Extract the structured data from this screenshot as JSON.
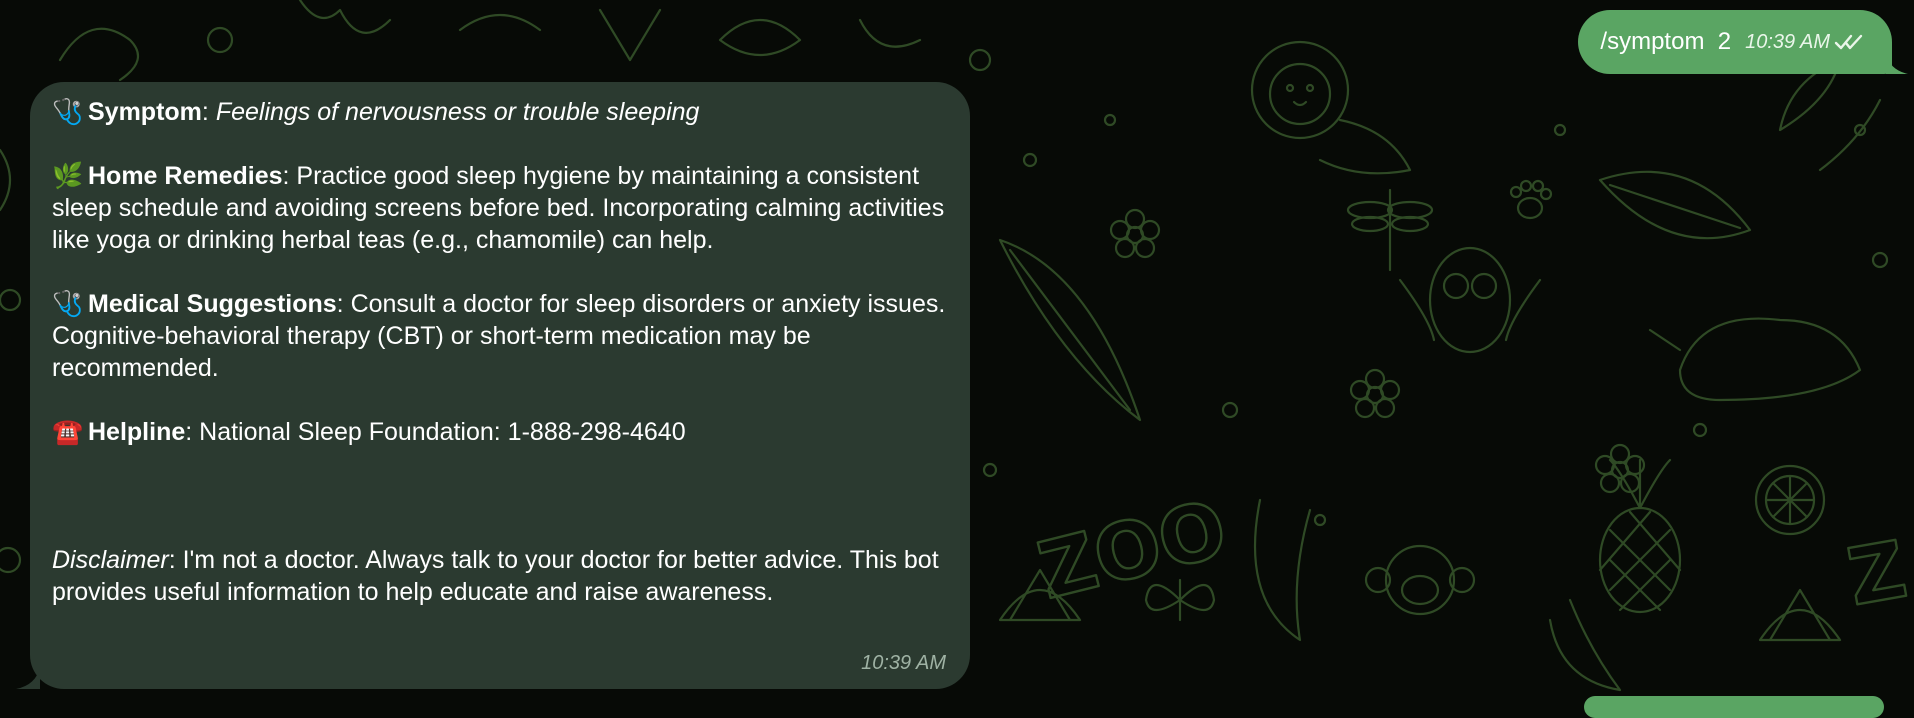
{
  "chat": {
    "outgoing": {
      "text": "/symptom  2",
      "time": "10:39 AM",
      "status_icon": "double-check-icon"
    },
    "incoming": {
      "symptom": {
        "emoji": "🩺",
        "icon": "stethoscope-icon",
        "label": "Symptom",
        "sep": ": ",
        "value": "Feelings of nervousness or trouble sleeping"
      },
      "home_remedies": {
        "emoji": "🌿",
        "icon": "herb-icon",
        "label": "Home Remedies",
        "text": ": Practice good sleep hygiene by maintaining a consistent sleep schedule and avoiding screens before bed. Incorporating calming activities like yoga or drinking herbal teas (e.g., chamomile) can help."
      },
      "medical_suggestions": {
        "emoji": "🩺",
        "icon": "stethoscope-icon",
        "label": "Medical Suggestions",
        "text": ": Consult a doctor for sleep disorders or anxiety issues. Cognitive-behavioral therapy (CBT) or short-term medication may be recommended."
      },
      "helpline": {
        "emoji": "☎️",
        "icon": "telephone-icon",
        "label": "Helpline",
        "text": ": National Sleep Foundation: 1-888-298-4640"
      },
      "disclaimer": {
        "label": "Disclaimer",
        "text": ": I'm not a doctor. Always talk to your doctor for better advice. This bot provides useful information to help educate and raise awareness."
      },
      "time": "10:39 AM"
    }
  },
  "theme": {
    "wallpaper_bg": "#070a06",
    "doodle_color": "#2f4a25",
    "outgoing_bubble": "#5aa563",
    "incoming_bubble": "#2b3a30",
    "incoming_time": "#9fb2a4"
  }
}
